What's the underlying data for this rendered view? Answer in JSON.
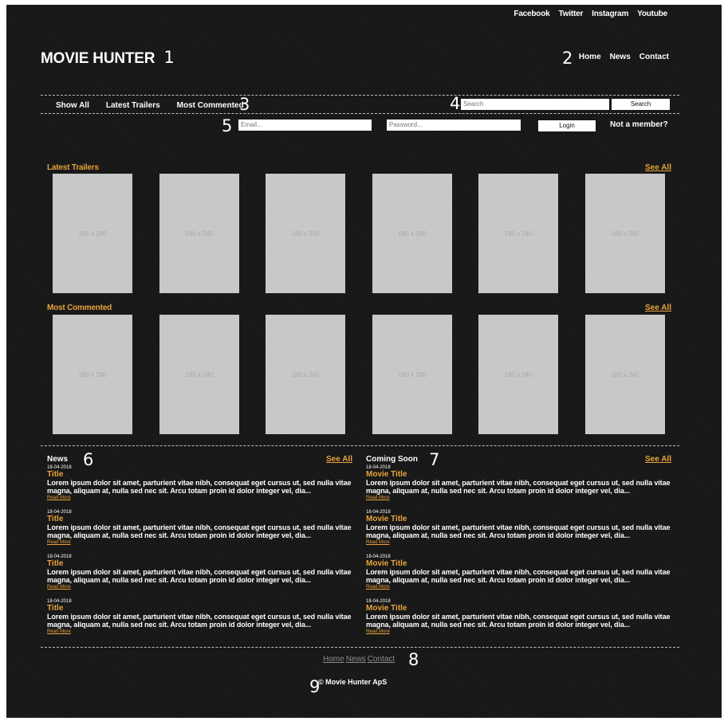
{
  "social": [
    "Facebook",
    "Twitter",
    "Instagram",
    "Youtube"
  ],
  "logo": "MOVIE HUNTER",
  "annotations": [
    "1",
    "2",
    "3",
    "4",
    "5",
    "6",
    "7",
    "8",
    "9"
  ],
  "main_nav": [
    "Home",
    "News",
    "Contact"
  ],
  "sub_nav": [
    "Show All",
    "Latest Trailers",
    "Most Commented"
  ],
  "search": {
    "placeholder": "Search",
    "button": "Search"
  },
  "login": {
    "email_placeholder": "Email...",
    "password_placeholder": "Password...",
    "button": "Login",
    "signup": "Not a member?"
  },
  "latest_trailers": {
    "title": "Latest Trailers",
    "see_all": "See All",
    "posters": [
      "180 x 240",
      "180 x 240",
      "180 x 240",
      "180 x 240",
      "180 x 240",
      "180 x 240"
    ]
  },
  "most_commented": {
    "title": "Most Commented",
    "see_all": "See All",
    "posters": [
      "180 x 240",
      "180 x 240",
      "180 x 240",
      "180 x 240",
      "180 x 240",
      "180 x 240"
    ]
  },
  "news": {
    "title": "News",
    "see_all": "See All",
    "items": [
      {
        "date": "18-04-2018",
        "title": "Title",
        "body": "Lorem ipsum dolor sit amet, parturient vitae nibh, consequat eget cursus ut, sed nulla vitae magna, aliquam at, nulla sed nec sit. Arcu totam proin id dolor integer vel, dia...",
        "read_more": "Read More"
      },
      {
        "date": "18-04-2018",
        "title": "Title",
        "body": "Lorem ipsum dolor sit amet, parturient vitae nibh, consequat eget cursus ut, sed nulla vitae magna, aliquam at, nulla sed nec sit. Arcu totam proin id dolor integer vel, dia...",
        "read_more": "Read More"
      },
      {
        "date": "18-04-2018",
        "title": "Title",
        "body": "Lorem ipsum dolor sit amet, parturient vitae nibh, consequat eget cursus ut, sed nulla vitae magna, aliquam at, nulla sed nec sit. Arcu totam proin id dolor integer vel, dia...",
        "read_more": "Read More"
      },
      {
        "date": "18-04-2018",
        "title": "Title",
        "body": "Lorem ipsum dolor sit amet, parturient vitae nibh, consequat eget cursus ut, sed nulla vitae magna, aliquam at, nulla sed nec sit. Arcu totam proin id dolor integer vel, dia...",
        "read_more": "Read More"
      }
    ]
  },
  "coming_soon": {
    "title": "Coming Soon",
    "see_all": "See All",
    "items": [
      {
        "date": "18-04-2018",
        "title": "Movie Title",
        "body": "Lorem ipsum dolor sit amet, parturient vitae nibh, consequat eget cursus ut, sed nulla vitae magna, aliquam at, nulla sed nec sit. Arcu totam proin id dolor integer vel, dia...",
        "read_more": "Read More"
      },
      {
        "date": "18-04-2018",
        "title": "Movie Title",
        "body": "Lorem ipsum dolor sit amet, parturient vitae nibh, consequat eget cursus ut, sed nulla vitae magna, aliquam at, nulla sed nec sit. Arcu totam proin id dolor integer vel, dia...",
        "read_more": "Read More"
      },
      {
        "date": "18-04-2018",
        "title": "Movie Title",
        "body": "Lorem ipsum dolor sit amet, parturient vitae nibh, consequat eget cursus ut, sed nulla vitae magna, aliquam at, nulla sed nec sit. Arcu totam proin id dolor integer vel, dia...",
        "read_more": "Read More"
      },
      {
        "date": "18-04-2018",
        "title": "Movie Title",
        "body": "Lorem ipsum dolor sit amet, parturient vitae nibh, consequat eget cursus ut, sed nulla vitae magna, aliquam at, nulla sed nec sit. Arcu totam proin id dolor integer vel, dia...",
        "read_more": "Read More"
      }
    ]
  },
  "footer": {
    "nav": [
      "Home",
      "News",
      "Contact"
    ],
    "copyright": "© Movie Hunter ApS"
  },
  "colors": {
    "background": "#161616",
    "accent": "#e8a33b",
    "poster": "#c8c8c8"
  }
}
